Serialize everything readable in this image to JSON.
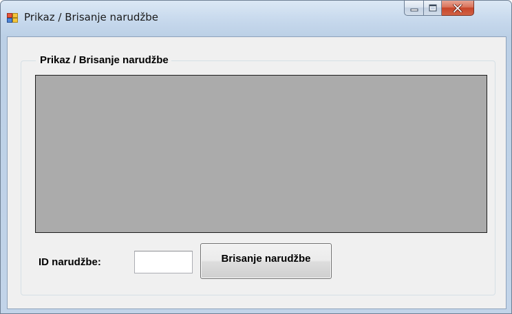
{
  "window": {
    "title": "Prikaz / Brisanje narudžbe",
    "app_icon": "windows-form-icon",
    "caption_icons": [
      "minimize-icon",
      "maximize-icon",
      "close-icon"
    ]
  },
  "groupbox": {
    "legend": "Prikaz / Brisanje narudžbe"
  },
  "form": {
    "id_label": "ID narudžbe:",
    "id_value": "",
    "delete_button_label": "Brisanje narudžbe"
  },
  "colors": {
    "grid_background": "#ababab",
    "form_background": "#f0f0f0",
    "close_button": "#c7452a"
  }
}
